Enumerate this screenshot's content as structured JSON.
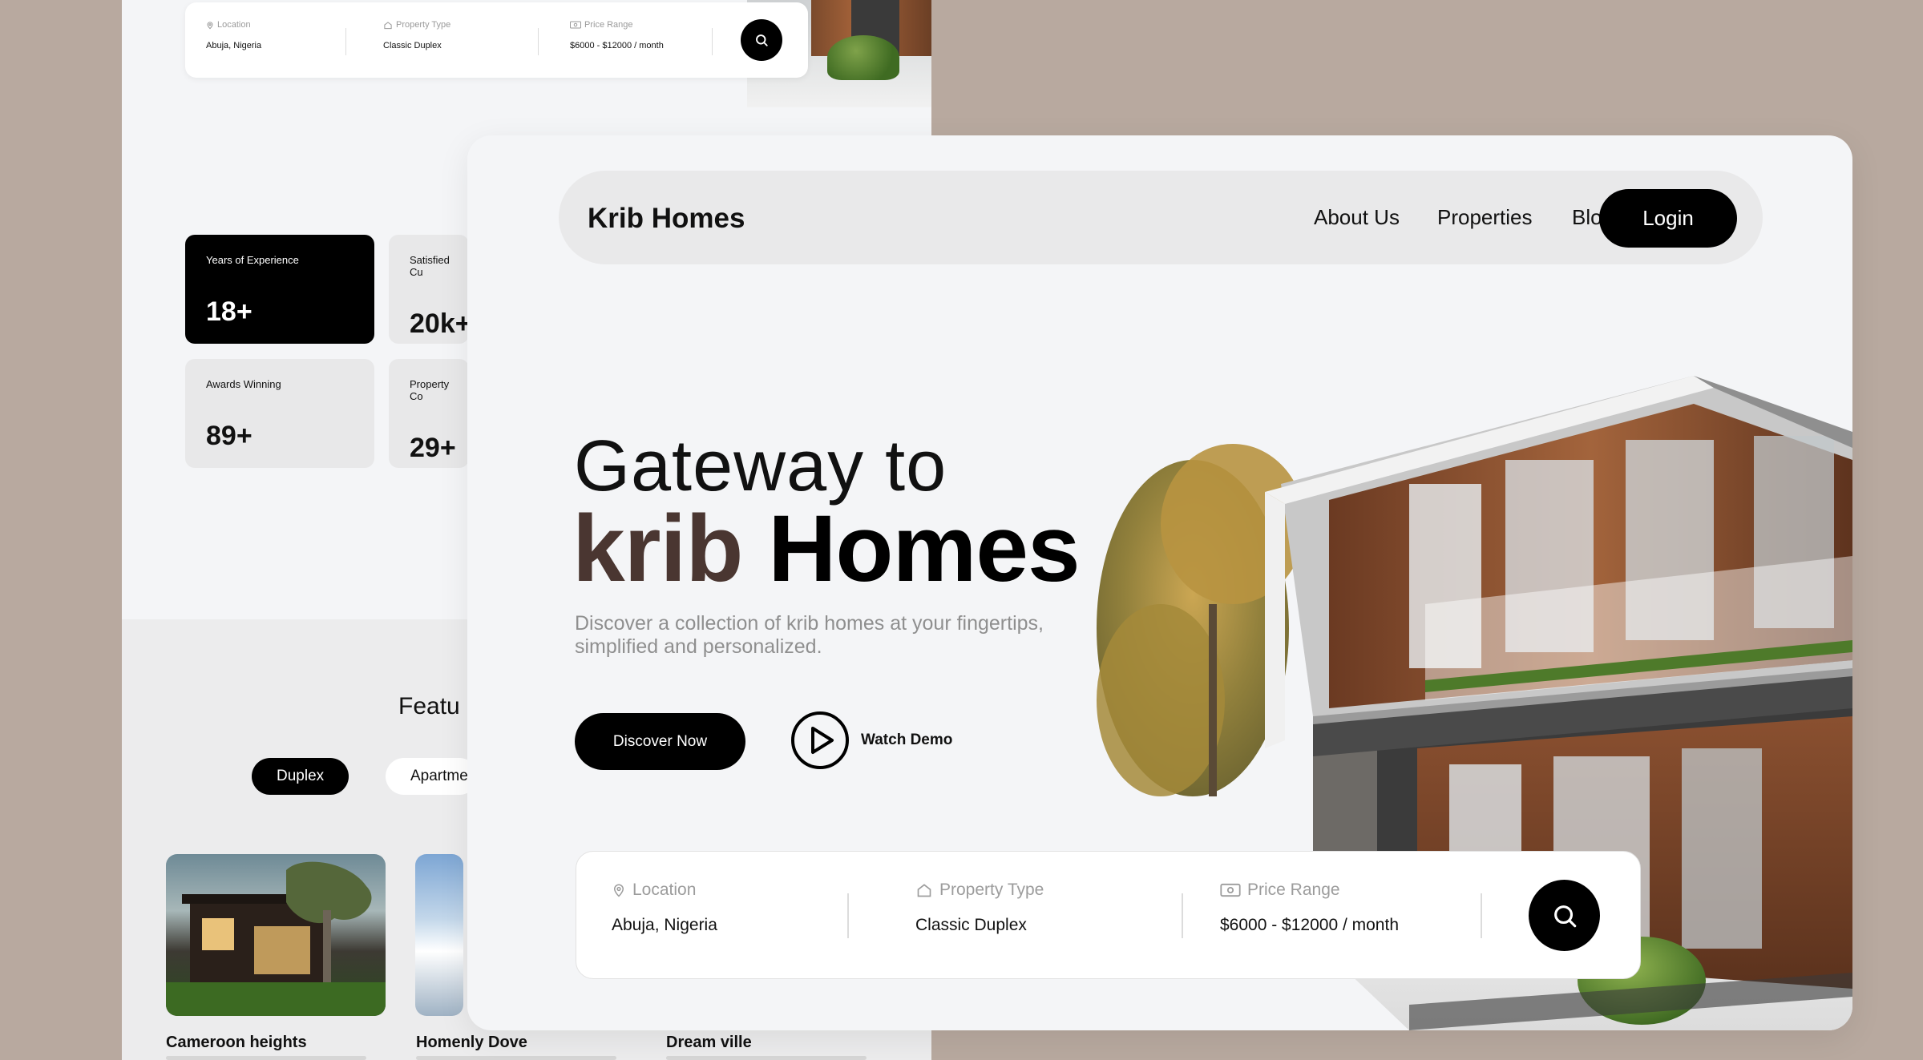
{
  "background_page": {
    "search": {
      "location_label": "Location",
      "location_value": "Abuja, Nigeria",
      "type_label": "Property Type",
      "type_value": "Classic Duplex",
      "price_label": "Price Range",
      "price_value": "$6000 - $12000 / month"
    },
    "stats": [
      {
        "label": "Years of Experience",
        "value": "18+"
      },
      {
        "label": "Satisfied Cu",
        "value": "20k+"
      },
      {
        "label": "Awards Winning",
        "value": "89+"
      },
      {
        "label": "Property Co",
        "value": "29+"
      }
    ],
    "featured_title": "Featu",
    "filters": [
      "Duplex",
      "Apartme"
    ],
    "properties": [
      "Cameroon heights",
      "Homenly Dove",
      "Dream ville"
    ]
  },
  "navbar": {
    "brand": "Krib Homes",
    "links": [
      "About Us",
      "Properties",
      "Blogs"
    ],
    "login": "Login"
  },
  "hero": {
    "line1": "Gateway to",
    "line2_accent": "krib",
    "line2_rest": "Homes",
    "subtitle": "Discover a collection of krib homes at your fingertips, simplified and personalized.",
    "cta_primary": "Discover Now",
    "cta_secondary": "Watch Demo"
  },
  "search": {
    "location_label": "Location",
    "location_value": "Abuja, Nigeria",
    "type_label": "Property Type",
    "type_value": "Classic Duplex",
    "price_label": "Price Range",
    "price_value": "$6000 - $12000 / month"
  },
  "icons": {
    "location": "location-pin-icon",
    "property_type": "house-icon",
    "price": "money-icon",
    "search": "search-icon",
    "play": "play-icon"
  },
  "colors": {
    "background": "#b8a99f",
    "card": "#f4f5f7",
    "accent_brown": "#4a3631",
    "primary_black": "#000000"
  }
}
